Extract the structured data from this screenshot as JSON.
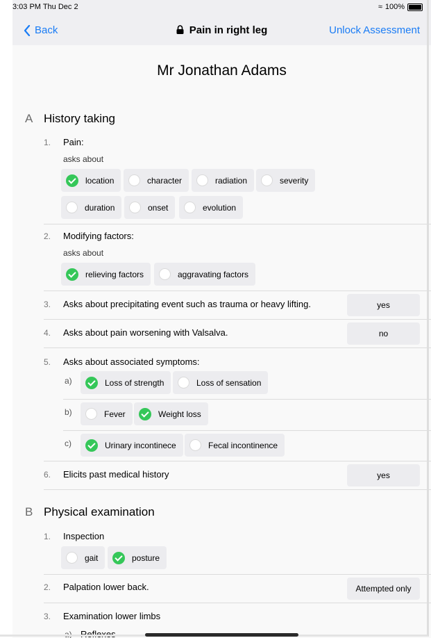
{
  "status": {
    "time_date": "3:03 PM  Thu Dec 2",
    "battery": "100%",
    "icons": [
      "wifi-icon",
      "battery-icon"
    ]
  },
  "nav": {
    "back_label": "Back",
    "title": "Pain in right leg",
    "unlock_label": "Unlock Assessment"
  },
  "colors": {
    "accent": "#1a7cf5",
    "check": "#35c759",
    "chip_bg": "#ececef",
    "bar_bg": "#efeff2"
  },
  "patient_name": "Mr Jonathan Adams",
  "sections": [
    {
      "letter": "A",
      "title": "History taking",
      "items": [
        {
          "num": "1.",
          "text": "Pain:",
          "sub": "asks about",
          "chips": [
            {
              "label": "location",
              "checked": true
            },
            {
              "label": "character",
              "checked": false
            },
            {
              "label": "radiation",
              "checked": false
            },
            {
              "label": "severity",
              "checked": false
            },
            {
              "label": "duration",
              "checked": false
            },
            {
              "label": "onset",
              "checked": false
            },
            {
              "label": "evolution",
              "checked": false
            }
          ]
        },
        {
          "num": "2.",
          "text": "Modifying factors:",
          "sub": "asks about",
          "chips": [
            {
              "label": "relieving factors",
              "checked": true
            },
            {
              "label": "aggravating factors",
              "checked": false
            }
          ]
        },
        {
          "num": "3.",
          "text": "Asks about precipitating event such as trauma or heavy lifting.",
          "answer": "yes"
        },
        {
          "num": "4.",
          "text": "Asks about pain worsening with Valsalva.",
          "answer": "no"
        },
        {
          "num": "5.",
          "text": "Asks about associated symptoms:",
          "subgroups": [
            {
              "letter": "a)",
              "chips": [
                {
                  "label": "Loss of strength",
                  "checked": true
                },
                {
                  "label": "Loss of sensation",
                  "checked": false
                }
              ]
            },
            {
              "letter": "b)",
              "chips": [
                {
                  "label": "Fever",
                  "checked": false
                },
                {
                  "label": "Weight loss",
                  "checked": true
                }
              ]
            },
            {
              "letter": "c)",
              "chips": [
                {
                  "label": "Urinary incontinece",
                  "checked": true
                },
                {
                  "label": "Fecal incontinence",
                  "checked": false
                }
              ]
            }
          ]
        },
        {
          "num": "6.",
          "text": "Elicits past medical history",
          "answer": "yes"
        }
      ]
    },
    {
      "letter": "B",
      "title": "Physical examination",
      "items": [
        {
          "num": "1.",
          "text": "Inspection",
          "chips": [
            {
              "label": "gait",
              "checked": false
            },
            {
              "label": "posture",
              "checked": true
            }
          ]
        },
        {
          "num": "2.",
          "text": "Palpation lower back.",
          "answer": "Attempted only"
        },
        {
          "num": "3.",
          "text": "Examination lower limbs",
          "subgroups": [
            {
              "letter": "a)",
              "text": "Reflexes"
            }
          ]
        }
      ]
    }
  ]
}
